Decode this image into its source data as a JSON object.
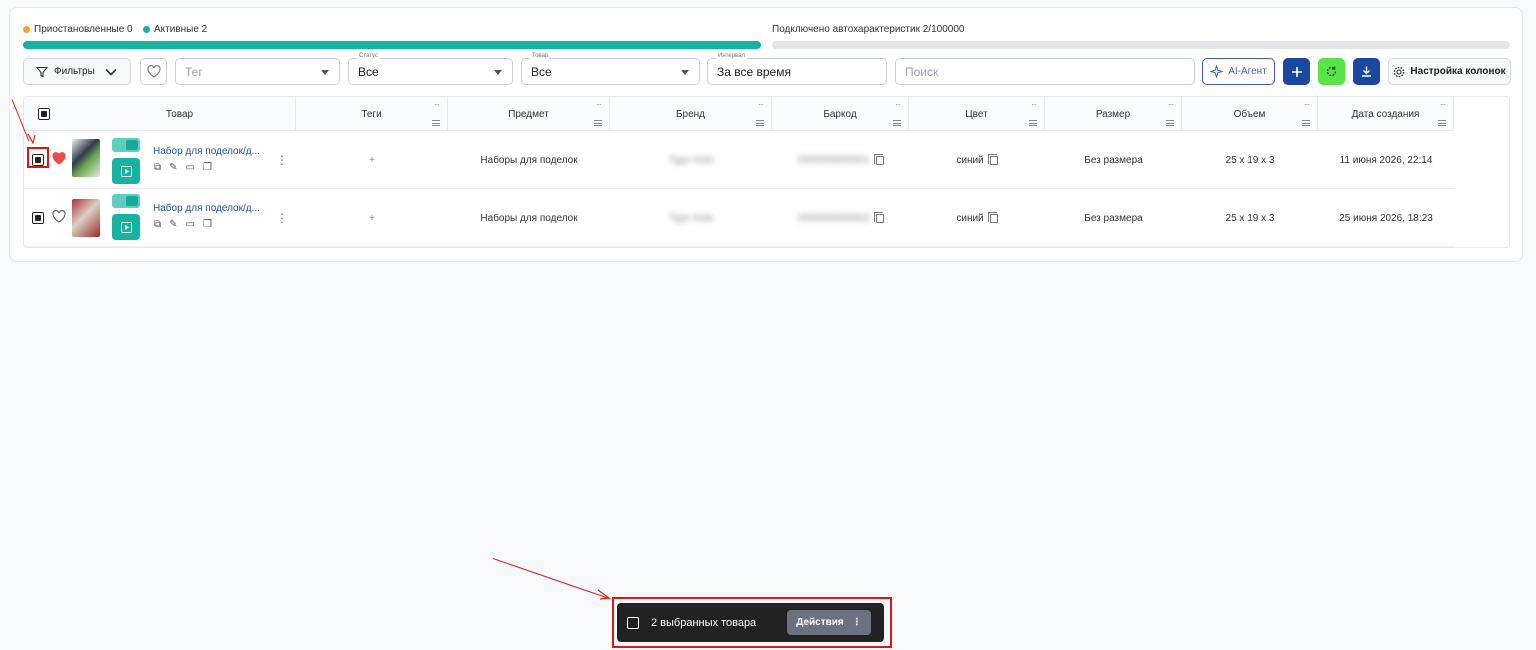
{
  "stats": {
    "paused_label": "Приостановленные 0",
    "active_label": "Активные 2",
    "connected_label": "Подключено автохарактеристик 2/100000",
    "paused_color": "#f5a623",
    "active_color": "#17b3a0",
    "progress_fraction": 2e-05
  },
  "filters": {
    "filters_button": "Фильтры",
    "tag_placeholder": "Тег",
    "status_label": "Статус",
    "status_value": "Все",
    "product_label": "Товар",
    "product_value": "Все",
    "interval_label": "Интервал",
    "interval_value": "За все время",
    "search_placeholder": "Поиск",
    "ai_button": "AI-Агент",
    "columns_button": "Настройка колонок"
  },
  "table": {
    "headers": [
      "Товар",
      "Теги",
      "Предмет",
      "Бренд",
      "Баркод",
      "Цвет",
      "Размер",
      "Объем",
      "Дата создания"
    ],
    "rows": [
      {
        "name": "Набор для поделок/д...",
        "tags": "+",
        "subject": "Наборы для поделок",
        "brand": "Tiger Kids",
        "barcode": "2000000000001",
        "color": "синий",
        "size": "Без размера",
        "volume": "25 x 19 x 3",
        "created": "11 июня 2026, 22:14",
        "favorite": true
      },
      {
        "name": "Набор для поделок/д...",
        "tags": "+",
        "subject": "Наборы для поделок",
        "brand": "Tiger Kids",
        "barcode": "2000000000002",
        "color": "синий",
        "size": "Без размера",
        "volume": "25 x 19 x 3",
        "created": "25 июня 2026, 18:23",
        "favorite": false
      }
    ]
  },
  "selection_bar": {
    "count_label": "2 выбранных товара",
    "actions_label": "Действия"
  },
  "colors": {
    "accent": "#17b3a0",
    "primary": "#1a47a0",
    "refresh": "#5be34a",
    "annotation": "#d61a1a"
  }
}
